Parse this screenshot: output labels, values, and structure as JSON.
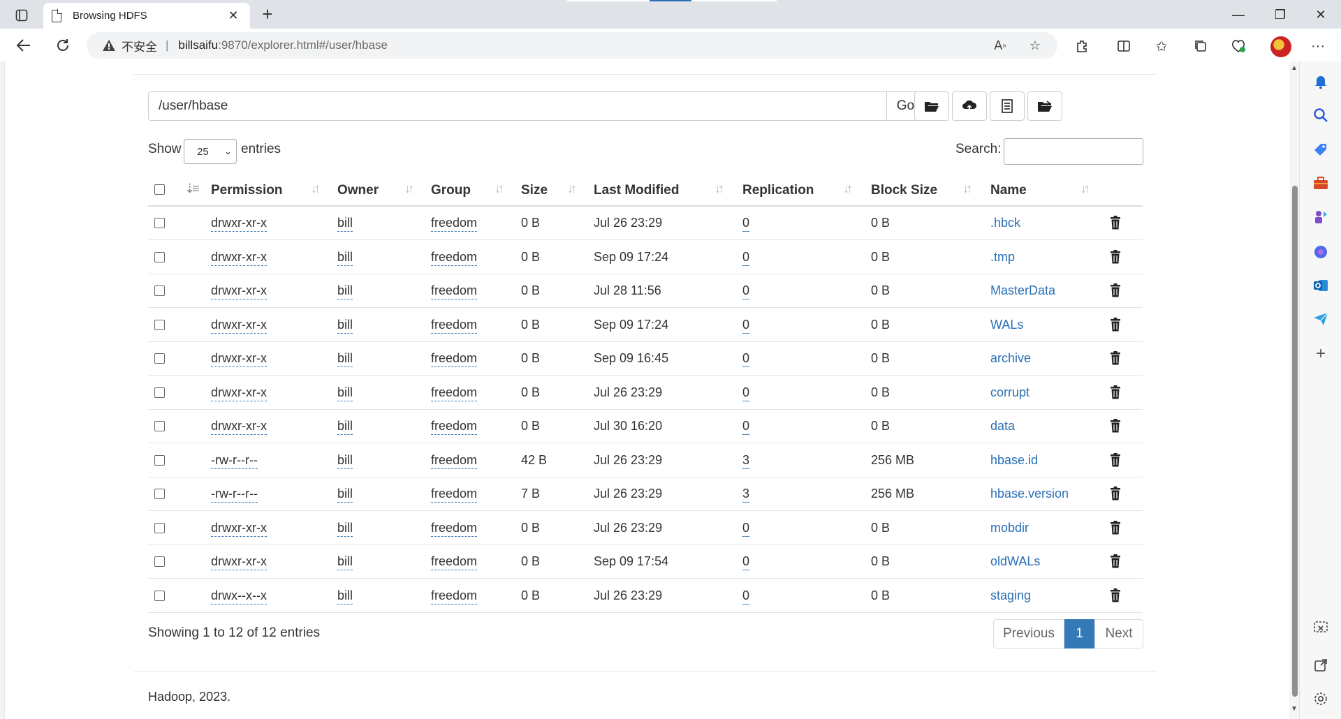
{
  "browser": {
    "tab_title": "Browsing HDFS",
    "tab_close": "✕",
    "new_tab": "+",
    "security_label": "不安全",
    "url_host": "billsaifu",
    "url_path": ":9870/explorer.html#/user/hbase",
    "minimize": "—",
    "restore": "❐",
    "close": "✕"
  },
  "page": {
    "path_value": "/user/hbase",
    "go_label": "Go!",
    "show_label": "Show",
    "entries_select": "25",
    "entries_label": "entries",
    "search_label": "Search:",
    "columns": [
      "Permission",
      "Owner",
      "Group",
      "Size",
      "Last Modified",
      "Replication",
      "Block Size",
      "Name"
    ],
    "rows": [
      {
        "permission": "drwxr-xr-x",
        "owner": "bill",
        "group": "freedom",
        "size": "0 B",
        "modified": "Jul 26 23:29",
        "replication": "0",
        "block_size": "0 B",
        "name": ".hbck"
      },
      {
        "permission": "drwxr-xr-x",
        "owner": "bill",
        "group": "freedom",
        "size": "0 B",
        "modified": "Sep 09 17:24",
        "replication": "0",
        "block_size": "0 B",
        "name": ".tmp"
      },
      {
        "permission": "drwxr-xr-x",
        "owner": "bill",
        "group": "freedom",
        "size": "0 B",
        "modified": "Jul 28 11:56",
        "replication": "0",
        "block_size": "0 B",
        "name": "MasterData"
      },
      {
        "permission": "drwxr-xr-x",
        "owner": "bill",
        "group": "freedom",
        "size": "0 B",
        "modified": "Sep 09 17:24",
        "replication": "0",
        "block_size": "0 B",
        "name": "WALs"
      },
      {
        "permission": "drwxr-xr-x",
        "owner": "bill",
        "group": "freedom",
        "size": "0 B",
        "modified": "Sep 09 16:45",
        "replication": "0",
        "block_size": "0 B",
        "name": "archive"
      },
      {
        "permission": "drwxr-xr-x",
        "owner": "bill",
        "group": "freedom",
        "size": "0 B",
        "modified": "Jul 26 23:29",
        "replication": "0",
        "block_size": "0 B",
        "name": "corrupt"
      },
      {
        "permission": "drwxr-xr-x",
        "owner": "bill",
        "group": "freedom",
        "size": "0 B",
        "modified": "Jul 30 16:20",
        "replication": "0",
        "block_size": "0 B",
        "name": "data"
      },
      {
        "permission": "-rw-r--r--",
        "owner": "bill",
        "group": "freedom",
        "size": "42 B",
        "modified": "Jul 26 23:29",
        "replication": "3",
        "block_size": "256 MB",
        "name": "hbase.id"
      },
      {
        "permission": "-rw-r--r--",
        "owner": "bill",
        "group": "freedom",
        "size": "7 B",
        "modified": "Jul 26 23:29",
        "replication": "3",
        "block_size": "256 MB",
        "name": "hbase.version"
      },
      {
        "permission": "drwxr-xr-x",
        "owner": "bill",
        "group": "freedom",
        "size": "0 B",
        "modified": "Jul 26 23:29",
        "replication": "0",
        "block_size": "0 B",
        "name": "mobdir"
      },
      {
        "permission": "drwxr-xr-x",
        "owner": "bill",
        "group": "freedom",
        "size": "0 B",
        "modified": "Sep 09 17:54",
        "replication": "0",
        "block_size": "0 B",
        "name": "oldWALs"
      },
      {
        "permission": "drwx--x--x",
        "owner": "bill",
        "group": "freedom",
        "size": "0 B",
        "modified": "Jul 26 23:29",
        "replication": "0",
        "block_size": "0 B",
        "name": "staging"
      }
    ],
    "info": "Showing 1 to 12 of 12 entries",
    "pager": {
      "previous": "Previous",
      "current": "1",
      "next": "Next"
    },
    "footer": "Hadoop, 2023."
  },
  "colors": {
    "link": "#2a6fb5",
    "accent": "#337ab7"
  }
}
